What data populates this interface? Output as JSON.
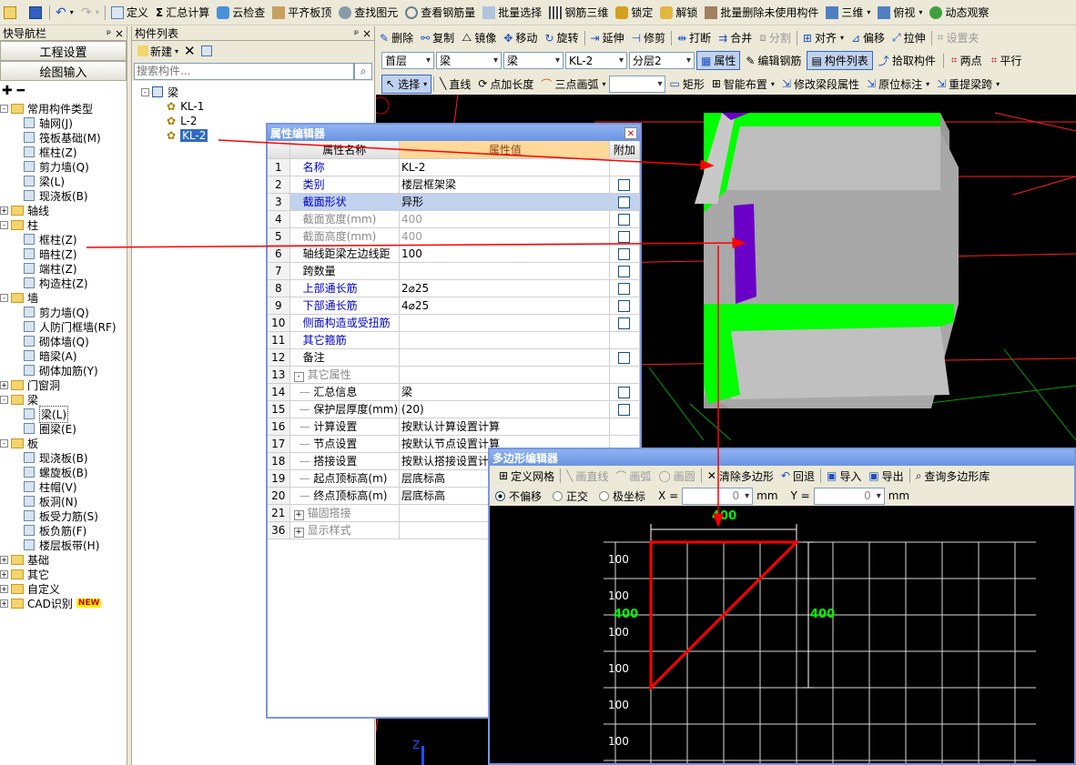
{
  "toolbar1": [
    {
      "name": "save-icon",
      "label": ""
    },
    {
      "name": "undo-icon",
      "label": ""
    },
    {
      "name": "define-button",
      "label": "定义"
    },
    {
      "name": "sum-calc-button",
      "label": "汇总计算"
    },
    {
      "name": "cloud-check-button",
      "label": "云检查"
    },
    {
      "name": "flush-slab-top-button",
      "label": "平齐板顶"
    },
    {
      "name": "find-element-button",
      "label": "查找图元"
    },
    {
      "name": "view-rebar-button",
      "label": "查看钢筋量"
    },
    {
      "name": "batch-select-button",
      "label": "批量选择"
    },
    {
      "name": "rebar-3d-button",
      "label": "钢筋三维"
    },
    {
      "name": "lock-button",
      "label": "锁定"
    },
    {
      "name": "unlock-button",
      "label": "解锁"
    },
    {
      "name": "batch-delete-button",
      "label": "批量删除未使用构件"
    },
    {
      "name": "view-3d-button",
      "label": "三维"
    },
    {
      "name": "top-view-button",
      "label": "俯视"
    },
    {
      "name": "dynamic-view-button",
      "label": "动态观察"
    }
  ],
  "toolbar2": [
    "删除",
    "复制",
    "镜像",
    "移动",
    "旋转",
    "延伸",
    "修剪",
    "打断",
    "合并",
    "分割",
    "对齐",
    "偏移",
    "拉伸",
    "设置夹"
  ],
  "toolbar3": {
    "floor": "首层",
    "type1": "梁",
    "type2": "梁",
    "comp": "KL-2",
    "layer": "分层2",
    "props": "属性",
    "edit_rebar": "编辑钢筋",
    "comp_list": "构件列表",
    "pick": "拾取构件",
    "two_points": "两点",
    "parallel": "平行"
  },
  "toolbar4": {
    "select": "选择",
    "line": "直线",
    "point_len": "点加长度",
    "arc3": "三点画弧",
    "rect": "矩形",
    "smart": "智能布置",
    "modify_seg": "修改梁段属性",
    "orig_mark": "原位标注",
    "relift": "重提梁跨"
  },
  "nav": {
    "title": "快导航栏",
    "btn1": "工程设置",
    "btn2": "绘图输入"
  },
  "tree": [
    {
      "lvl": 0,
      "exp": "-",
      "folder": true,
      "label": "常用构件类型"
    },
    {
      "lvl": 1,
      "label": "轴网(J)"
    },
    {
      "lvl": 1,
      "label": "筏板基础(M)"
    },
    {
      "lvl": 1,
      "label": "框柱(Z)"
    },
    {
      "lvl": 1,
      "label": "剪力墙(Q)"
    },
    {
      "lvl": 1,
      "label": "梁(L)"
    },
    {
      "lvl": 1,
      "label": "现浇板(B)"
    },
    {
      "lvl": 0,
      "exp": "+",
      "folder": true,
      "label": "轴线"
    },
    {
      "lvl": 0,
      "exp": "-",
      "folder": true,
      "label": "柱"
    },
    {
      "lvl": 1,
      "label": "框柱(Z)"
    },
    {
      "lvl": 1,
      "label": "暗柱(Z)"
    },
    {
      "lvl": 1,
      "label": "端柱(Z)"
    },
    {
      "lvl": 1,
      "label": "构造柱(Z)"
    },
    {
      "lvl": 0,
      "exp": "-",
      "folder": true,
      "label": "墙"
    },
    {
      "lvl": 1,
      "label": "剪力墙(Q)"
    },
    {
      "lvl": 1,
      "label": "人防门框墙(RF)"
    },
    {
      "lvl": 1,
      "label": "砌体墙(Q)"
    },
    {
      "lvl": 1,
      "label": "暗梁(A)"
    },
    {
      "lvl": 1,
      "label": "砌体加筋(Y)"
    },
    {
      "lvl": 0,
      "exp": "+",
      "folder": true,
      "label": "门窗洞"
    },
    {
      "lvl": 0,
      "exp": "-",
      "folder": true,
      "label": "梁"
    },
    {
      "lvl": 1,
      "label": "梁(L)",
      "sel": true
    },
    {
      "lvl": 1,
      "label": "圈梁(E)"
    },
    {
      "lvl": 0,
      "exp": "-",
      "folder": true,
      "label": "板"
    },
    {
      "lvl": 1,
      "label": "现浇板(B)"
    },
    {
      "lvl": 1,
      "label": "螺旋板(B)"
    },
    {
      "lvl": 1,
      "label": "柱帽(V)"
    },
    {
      "lvl": 1,
      "label": "板洞(N)"
    },
    {
      "lvl": 1,
      "label": "板受力筋(S)"
    },
    {
      "lvl": 1,
      "label": "板负筋(F)"
    },
    {
      "lvl": 1,
      "label": "楼层板带(H)"
    },
    {
      "lvl": 0,
      "exp": "+",
      "folder": true,
      "label": "基础"
    },
    {
      "lvl": 0,
      "exp": "+",
      "folder": true,
      "label": "其它"
    },
    {
      "lvl": 0,
      "exp": "+",
      "folder": true,
      "label": "自定义"
    },
    {
      "lvl": 0,
      "exp": "+",
      "folder": true,
      "label": "CAD识别",
      "badge": "NEW"
    }
  ],
  "complist": {
    "title": "构件列表",
    "new": "新建",
    "search_ph": "搜索构件...",
    "root": "梁",
    "items": [
      "KL-1",
      "L-2",
      "KL-2"
    ]
  },
  "prop": {
    "title": "属性编辑器",
    "headers": [
      "属性名称",
      "属性值",
      "附加"
    ],
    "rows": [
      {
        "n": "1",
        "k": "名称",
        "v": "KL-2",
        "c": "blue",
        "cb": false
      },
      {
        "n": "2",
        "k": "类别",
        "v": "楼层框架梁",
        "c": "blue",
        "cb": true
      },
      {
        "n": "3",
        "k": "截面形状",
        "v": "异形",
        "c": "blue",
        "cb": true,
        "hl": true
      },
      {
        "n": "4",
        "k": "截面宽度(mm)",
        "v": "400",
        "c": "grey",
        "cb": true
      },
      {
        "n": "5",
        "k": "截面高度(mm)",
        "v": "400",
        "c": "grey",
        "cb": true
      },
      {
        "n": "6",
        "k": "轴线距梁左边线距",
        "v": "100",
        "c": "",
        "cb": true
      },
      {
        "n": "7",
        "k": "跨数量",
        "v": "",
        "c": "",
        "cb": true
      },
      {
        "n": "8",
        "k": "上部通长筋",
        "v": "2⌀25",
        "c": "blue",
        "cb": true
      },
      {
        "n": "9",
        "k": "下部通长筋",
        "v": "4⌀25",
        "c": "blue",
        "cb": true
      },
      {
        "n": "10",
        "k": "侧面构造或受扭筋",
        "v": "",
        "c": "blue",
        "cb": true
      },
      {
        "n": "11",
        "k": "其它箍筋",
        "v": "",
        "c": "blue",
        "cb": false
      },
      {
        "n": "12",
        "k": "备注",
        "v": "",
        "c": "",
        "cb": true
      },
      {
        "n": "13",
        "k": "其它属性",
        "v": "",
        "c": "grey",
        "cb": false,
        "grp": "-"
      },
      {
        "n": "14",
        "k": "汇总信息",
        "v": "梁",
        "c": "",
        "cb": true,
        "sub": true
      },
      {
        "n": "15",
        "k": "保护层厚度(mm)",
        "v": "(20)",
        "c": "",
        "cb": true,
        "sub": true
      },
      {
        "n": "16",
        "k": "计算设置",
        "v": "按默认计算设置计算",
        "c": "",
        "cb": false,
        "sub": true
      },
      {
        "n": "17",
        "k": "节点设置",
        "v": "按默认节点设置计算",
        "c": "",
        "cb": false,
        "sub": true
      },
      {
        "n": "18",
        "k": "搭接设置",
        "v": "按默认搭接设置计算",
        "c": "",
        "cb": false,
        "sub": true
      },
      {
        "n": "19",
        "k": "起点顶标高(m)",
        "v": "层底标高",
        "c": "",
        "cb": false,
        "sub": true
      },
      {
        "n": "20",
        "k": "终点顶标高(m)",
        "v": "层底标高",
        "c": "",
        "cb": false,
        "sub": true
      },
      {
        "n": "21",
        "k": "锚固搭接",
        "v": "",
        "c": "grey",
        "cb": false,
        "grp": "+"
      },
      {
        "n": "36",
        "k": "显示样式",
        "v": "",
        "c": "grey",
        "cb": false,
        "grp": "+"
      }
    ]
  },
  "poly": {
    "title": "多边形编辑器",
    "tools": [
      "定义网格",
      "画直线",
      "画弧",
      "画圆",
      "清除多边形",
      "回退",
      "导入",
      "导出",
      "查询多边形库"
    ],
    "opt": [
      "不偏移",
      "正交",
      "极坐标"
    ],
    "x_label": "X =",
    "x_val": "0",
    "y_label": "Y =",
    "y_val": "0",
    "unit": "mm",
    "dim_top": "400",
    "dim_left": "400",
    "dim_right": "400",
    "row_labels": [
      "100",
      "100",
      "100",
      "100",
      "100",
      "100"
    ]
  },
  "axis_label": "Z",
  "colors": {
    "green": "#00ff00",
    "red": "#ff0000",
    "purple": "#6a00c8",
    "grey_block": "#9a9a9a"
  }
}
